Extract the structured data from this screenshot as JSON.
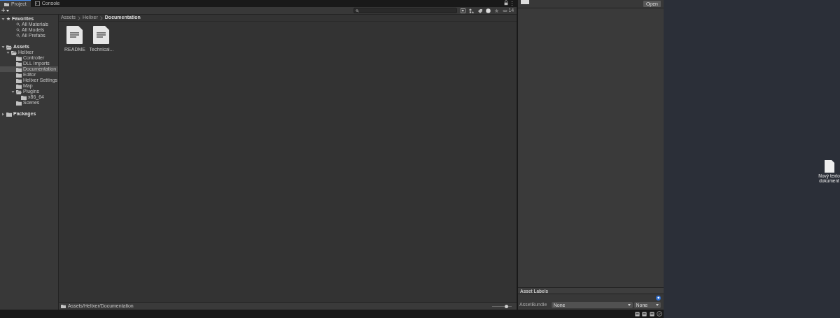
{
  "tabs": [
    {
      "label": "Project",
      "selected": true
    },
    {
      "label": "Console",
      "selected": false
    }
  ],
  "toolbar": {
    "add_label": "+",
    "hidden_count": "14"
  },
  "tree": [
    {
      "label": "Favorites",
      "kind": "favorites",
      "expanded": true,
      "selected": false,
      "children": [
        {
          "label": "All Materials",
          "kind": "search",
          "selected": false
        },
        {
          "label": "All Models",
          "kind": "search",
          "selected": false
        },
        {
          "label": "All Prefabs",
          "kind": "search",
          "selected": false
        }
      ]
    },
    {
      "label": "Assets",
      "kind": "folder",
      "expanded": true,
      "selected": false,
      "children": [
        {
          "label": "Helixer",
          "kind": "folder",
          "expanded": true,
          "selected": false,
          "children": [
            {
              "label": "Controller",
              "kind": "folder",
              "selected": false
            },
            {
              "label": "DLL Imports",
              "kind": "folder",
              "selected": false
            },
            {
              "label": "Documentation",
              "kind": "folder",
              "selected": true
            },
            {
              "label": "Editor",
              "kind": "folder",
              "selected": false
            },
            {
              "label": "Helixer Settings",
              "kind": "folder",
              "selected": false
            },
            {
              "label": "Map",
              "kind": "folder",
              "selected": false
            },
            {
              "label": "Plugins",
              "kind": "folder",
              "expanded": true,
              "selected": false,
              "children": [
                {
                  "label": "x86_64",
                  "kind": "folder",
                  "selected": false
                }
              ]
            },
            {
              "label": "Scenes",
              "kind": "folder",
              "selected": false
            }
          ]
        }
      ]
    },
    {
      "label": "Packages",
      "kind": "folder",
      "expanded": false,
      "selected": false
    }
  ],
  "breadcrumb": [
    "Assets",
    "Helixer",
    "Documentation"
  ],
  "files": [
    {
      "label": "README"
    },
    {
      "label": "Technical..."
    }
  ],
  "path_bar": {
    "path": "Assets/Helixer/Documentation",
    "zoom": {
      "level": 0.72
    }
  },
  "inspector": {
    "open_button": "Open",
    "labels_header": "Asset Labels",
    "asset_bundle_label": "AssetBundle",
    "bundle_name": "None",
    "bundle_variant": "None"
  },
  "desktop": {
    "icon_lines": [
      "Nový texto",
      "dokument"
    ]
  }
}
